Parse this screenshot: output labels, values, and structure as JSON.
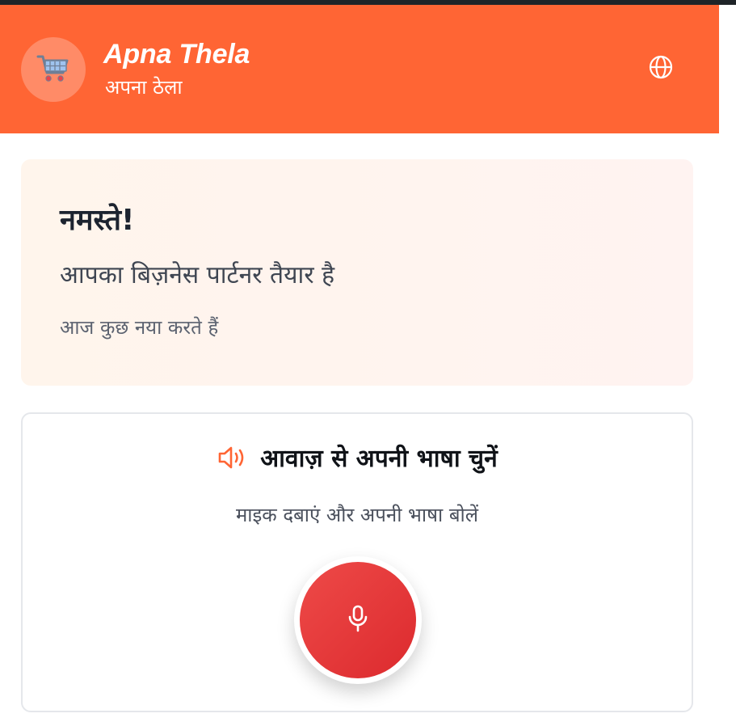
{
  "header": {
    "app_name": "Apna Thela",
    "app_name_hindi": "अपना ठेला",
    "logo_icon": "shopping-cart-icon",
    "language_icon": "globe-icon",
    "background_color": "#ff6534"
  },
  "welcome": {
    "title": "नमस्ते!",
    "subtitle": "आपका बिज़नेस पार्टनर तैयार है",
    "note": "आज कुछ नया करते हैं"
  },
  "voice_language": {
    "icon": "speaker-icon",
    "title": "आवाज़ से अपनी भाषा चुनें",
    "instruction": "माइक दबाएं और अपनी भाषा बोलें",
    "mic_icon": "microphone-icon",
    "mic_color": "#e53a3c"
  }
}
